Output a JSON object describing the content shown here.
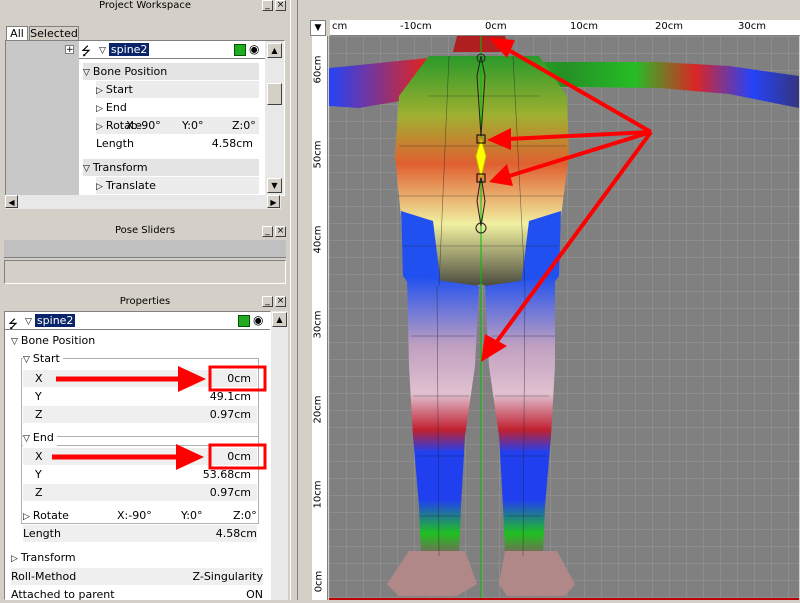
{
  "workspace": {
    "title": "Project Workspace",
    "tabs": [
      "All",
      "Selected"
    ],
    "bone_name": "spine2",
    "items": [
      {
        "label": "Bone Position",
        "kind": "group"
      },
      {
        "label": "Start",
        "kind": "sub"
      },
      {
        "label": "End",
        "kind": "sub"
      },
      {
        "label": "Rotate",
        "kind": "sub",
        "v1": "X:-90°",
        "v2": "Y:0°",
        "v3": "Z:0°"
      },
      {
        "label": "Length",
        "kind": "plain",
        "value": "4.58cm"
      },
      {
        "label": "Transform",
        "kind": "group"
      },
      {
        "label": "Translate",
        "kind": "sub"
      }
    ]
  },
  "pose": {
    "title": "Pose Sliders"
  },
  "properties": {
    "title": "Properties",
    "bone_name": "spine2",
    "bone_position_label": "Bone Position",
    "start_label": "Start",
    "start": {
      "x_label": "X",
      "x": "0cm",
      "y_label": "Y",
      "y": "49.1cm",
      "z_label": "Z",
      "z": "0.97cm"
    },
    "end_label": "End",
    "end": {
      "x_label": "X",
      "x": "0cm",
      "y_label": "Y",
      "y": "53.68cm",
      "z_label": "Z",
      "z": "0.97cm"
    },
    "rotate_label": "Rotate",
    "rotate_x": "X:-90°",
    "rotate_y": "Y:0°",
    "rotate_z": "Z:0°",
    "length_label": "Length",
    "length": "4.58cm",
    "transform_label": "Transform",
    "roll_label": "Roll-Method",
    "roll": "Z-Singularity",
    "attached_label": "Attached to parent",
    "attached": "ON"
  },
  "viewport": {
    "ruler_top": [
      "cm",
      "-10cm",
      "0cm",
      "10cm",
      "20cm",
      "30cm"
    ],
    "ruler_left": [
      "60cm",
      "50cm",
      "40cm",
      "30cm",
      "20cm",
      "10cm",
      "0cm"
    ],
    "menu_arrow": "▼"
  },
  "colors": {
    "accent_red": "#ff0000",
    "viewport_bg": "#808080",
    "grid": "#9a9a9a",
    "selection": "#0a246a",
    "bone_yellow": "#ffff00"
  }
}
